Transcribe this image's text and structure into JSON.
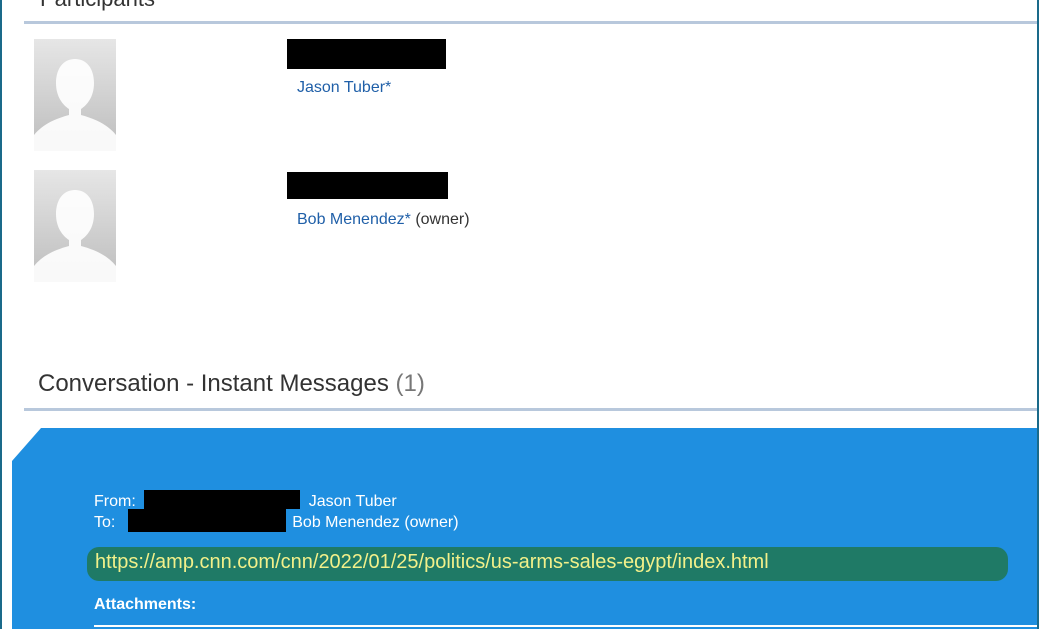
{
  "sections": {
    "participants_heading": "Participants",
    "conversation_heading": "Conversation - Instant Messages",
    "conversation_count": "(1)"
  },
  "participants": [
    {
      "name": "Jason Tuber*",
      "role": ""
    },
    {
      "name": "Bob Menendez*",
      "role": "(owner)"
    }
  ],
  "message": {
    "from_label": "From:",
    "from_name": "Jason Tuber",
    "to_label": "To:",
    "to_name": "Bob Menendez (owner)",
    "link": "https://amp.cnn.com/cnn/2022/01/25/politics/us-arms-sales-egypt/index.html",
    "attachments_label": "Attachments:"
  },
  "colors": {
    "panel": "#1f8fe0",
    "link_highlight": "#1f7a66",
    "link_text": "#f2f08a",
    "participant_link": "#1f5fa8"
  },
  "icons": {
    "avatar": "default-user-avatar-icon"
  }
}
